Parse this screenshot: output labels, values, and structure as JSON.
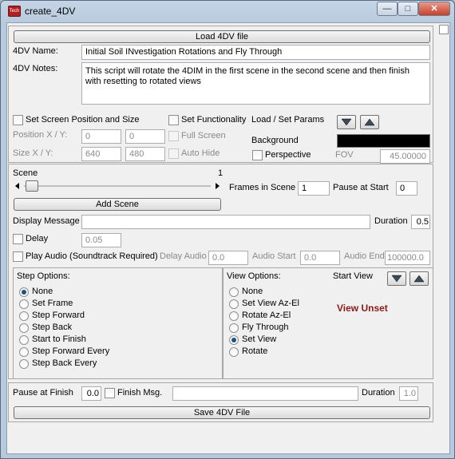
{
  "window": {
    "app_icon_text": "Tech",
    "title": "create_4DV",
    "controls": {
      "minimize": "—",
      "maximize": "□",
      "close": "✕"
    }
  },
  "load_button": "Load 4DV file",
  "name": {
    "label": "4DV Name:",
    "value": "Initial Soil INvestigation Rotations and Fly Through"
  },
  "notes": {
    "label": "4DV Notes:",
    "value": "This script will rotate the 4DIM in the first scene in the second scene and then finish with resetting to rotated views"
  },
  "screen": {
    "set_position_label": "Set Screen Position and Size",
    "position_label": "Position X / Y:",
    "pos_x": "0",
    "pos_y": "0",
    "size_label": "Size X / Y:",
    "size_x": "640",
    "size_y": "480"
  },
  "functionality": {
    "label": "Set Functionality",
    "full_screen": "Full Screen",
    "auto_hide": "Auto Hide"
  },
  "params": {
    "label": "Load / Set Params",
    "background_label": "Background",
    "background_color": "#000000",
    "perspective": "Perspective",
    "fov_label": "FOV",
    "fov_value": "45.00000"
  },
  "scene": {
    "label": "Scene",
    "number": "1",
    "frames_label": "Frames in Scene",
    "frames_value": "1",
    "pause_start_label": "Pause at Start",
    "pause_start_value": "0",
    "add_button": "Add Scene",
    "slider_fraction": 0.0
  },
  "message": {
    "label": "Display Message",
    "value": "",
    "duration_label": "Duration",
    "duration_value": "0.5"
  },
  "delay": {
    "label": "Delay",
    "value": "0.05"
  },
  "audio": {
    "label": "Play Audio (Soundtrack Required)",
    "delay_label": "Delay Audio",
    "delay_value": "0.0",
    "start_label": "Audio Start",
    "start_value": "0.0",
    "end_label": "Audio End",
    "end_value": "100000.0"
  },
  "step_options": {
    "label": "Step Options:",
    "items": [
      "None",
      "Set Frame",
      "Step Forward",
      "Step Back",
      "Start to Finish",
      "Step Forward Every",
      "Step Back Every"
    ],
    "selected": 0
  },
  "view_options": {
    "label": "View Options:",
    "start_view_label": "Start View",
    "items": [
      "None",
      "Set View Az-El",
      "Rotate Az-El",
      "Fly Through",
      "Set View",
      "Rotate"
    ],
    "selected": 4,
    "status": "View Unset"
  },
  "finish": {
    "pause_label": "Pause at Finish",
    "pause_value": "0.0",
    "msg_label": "Finish Msg.",
    "msg_value": "",
    "duration_label": "Duration",
    "duration_value": "1.0"
  },
  "save_button": "Save 4DV File",
  "icons": {
    "down": "triangle-down-icon",
    "up": "triangle-up-icon"
  }
}
